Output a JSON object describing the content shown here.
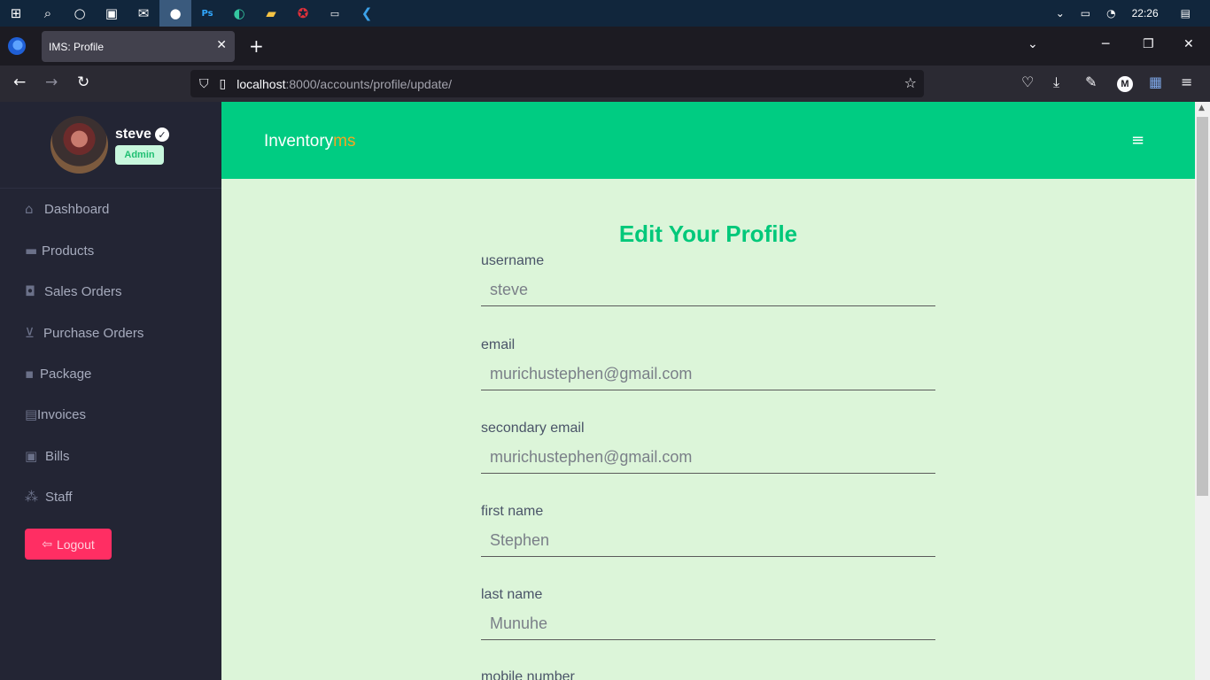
{
  "taskbar": {
    "clock": "22:26",
    "apps": [
      "start-icon",
      "search-icon",
      "cortana-icon",
      "task-view-icon",
      "mail-icon",
      "firefox-icon",
      "photoshop-icon",
      "edge-icon",
      "file-explorer-icon",
      "app-red-icon",
      "terminal-icon",
      "vscode-icon"
    ]
  },
  "browser": {
    "tab_title": "IMS: Profile",
    "url_host": "localhost",
    "url_path": ":8000/accounts/profile/update/"
  },
  "sidebar": {
    "user_name": "steve",
    "role_badge": "Admin",
    "items": [
      {
        "label": "Dashboard",
        "icon": "home-icon"
      },
      {
        "label": "Products",
        "icon": "folder-icon"
      },
      {
        "label": "Sales Orders",
        "icon": "shopping-bag-icon"
      },
      {
        "label": "Purchase Orders",
        "icon": "cart-icon"
      },
      {
        "label": "Package",
        "icon": "box-icon"
      },
      {
        "label": "Invoices",
        "icon": "file-icon"
      },
      {
        "label": "Bills",
        "icon": "money-icon"
      },
      {
        "label": "Staff",
        "icon": "users-icon"
      }
    ],
    "logout_label": "Logout"
  },
  "header": {
    "brand_main": "Inventory",
    "brand_accent": "ms"
  },
  "main": {
    "title": "Edit Your Profile",
    "fields": [
      {
        "label": "username",
        "value": "steve"
      },
      {
        "label": "email",
        "value": "murichustephen@gmail.com"
      },
      {
        "label": "secondary email",
        "value": "murichustephen@gmail.com"
      },
      {
        "label": "first name",
        "value": "Stephen"
      },
      {
        "label": "last name",
        "value": "Munuhe"
      },
      {
        "label": "mobile number",
        "value": ""
      }
    ]
  },
  "colors": {
    "accent": "#00cc82",
    "sidebar_bg": "#232534",
    "content_bg": "#dcf5d9",
    "logout": "#ff2e63",
    "brand_accent": "#f5a623"
  }
}
